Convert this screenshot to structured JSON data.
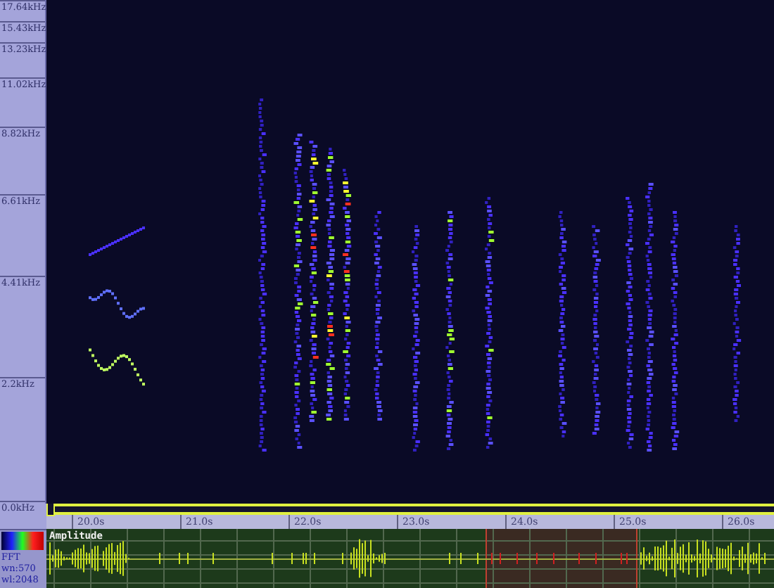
{
  "frequency_axis": {
    "labels": [
      "17.64kHz",
      "15.43kHz",
      "13.23kHz",
      "11.02kHz",
      "8.82kHz",
      "6.61kHz",
      "4.41kHz",
      "2.2kHz",
      "0.0kHz"
    ]
  },
  "time_axis": {
    "labels": [
      "20.0s",
      "21.0s",
      "22.0s",
      "23.0s",
      "24.0s",
      "25.0s",
      "26.0s"
    ]
  },
  "legend": {
    "title": "Amplitude",
    "lines": [
      "FFT",
      "wn:570",
      "wl:2048"
    ]
  }
}
